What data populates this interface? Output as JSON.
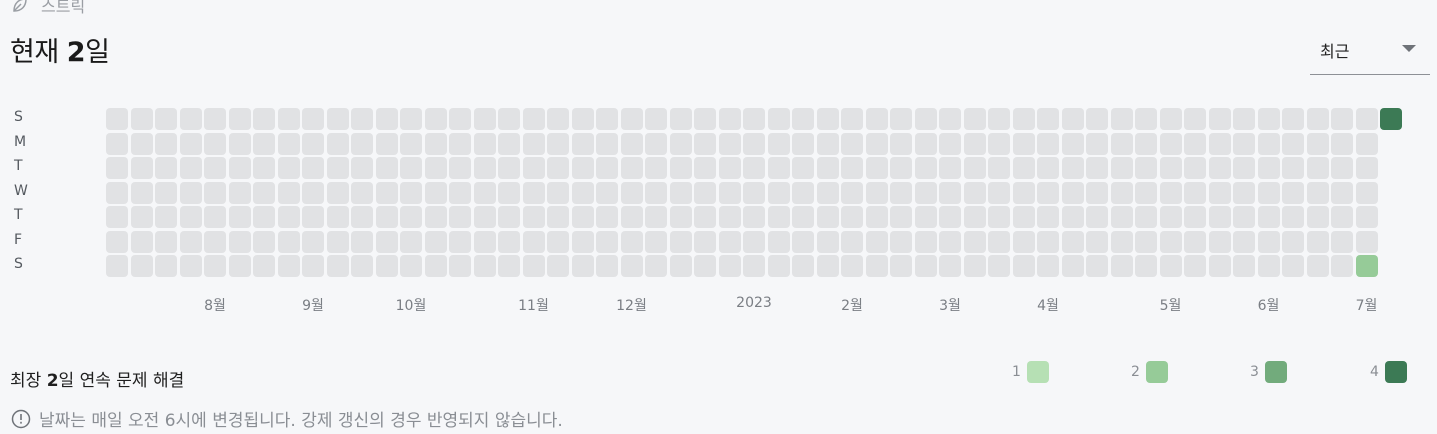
{
  "section": {
    "label": "스트릭",
    "icon": "leaf-icon"
  },
  "headline": {
    "prefix": "현재 ",
    "count": "2",
    "suffix": "일"
  },
  "dropdown": {
    "selected": "최근",
    "icon": "chevron-down-icon"
  },
  "heatmap": {
    "day_labels": [
      "S",
      "M",
      "T",
      "W",
      "T",
      "F",
      "S"
    ],
    "weeks": 53,
    "active_cells": [
      {
        "week": 51,
        "day": 6,
        "level": 2
      },
      {
        "week": 52,
        "day": 0,
        "level": 4
      }
    ],
    "month_labels": [
      {
        "label": "8월",
        "week": 4
      },
      {
        "label": "9월",
        "week": 8
      },
      {
        "label": "10월",
        "week": 12
      },
      {
        "label": "11월",
        "week": 17
      },
      {
        "label": "12월",
        "week": 21
      },
      {
        "label": "2023",
        "week": 26
      },
      {
        "label": "2월",
        "week": 30
      },
      {
        "label": "3월",
        "week": 34
      },
      {
        "label": "4월",
        "week": 38
      },
      {
        "label": "5월",
        "week": 43
      },
      {
        "label": "6월",
        "week": 47
      },
      {
        "label": "7월",
        "week": 51
      }
    ]
  },
  "longest": {
    "prefix": "최장 ",
    "count": "2",
    "suffix": "일 연속 문제 해결"
  },
  "legend": [
    {
      "label": "1",
      "color": "#b6e0b4"
    },
    {
      "label": "2",
      "color": "#96cb98"
    },
    {
      "label": "3",
      "color": "#72ab7c"
    },
    {
      "label": "4",
      "color": "#3c7a55"
    }
  ],
  "notice": {
    "text": "날짜는 매일 오전 6시에 변경됩니다. 강제 갱신의 경우 반영되지 않습니다.",
    "icon": "info-icon"
  },
  "colors": {
    "empty_cell": "#e1e2e4"
  }
}
